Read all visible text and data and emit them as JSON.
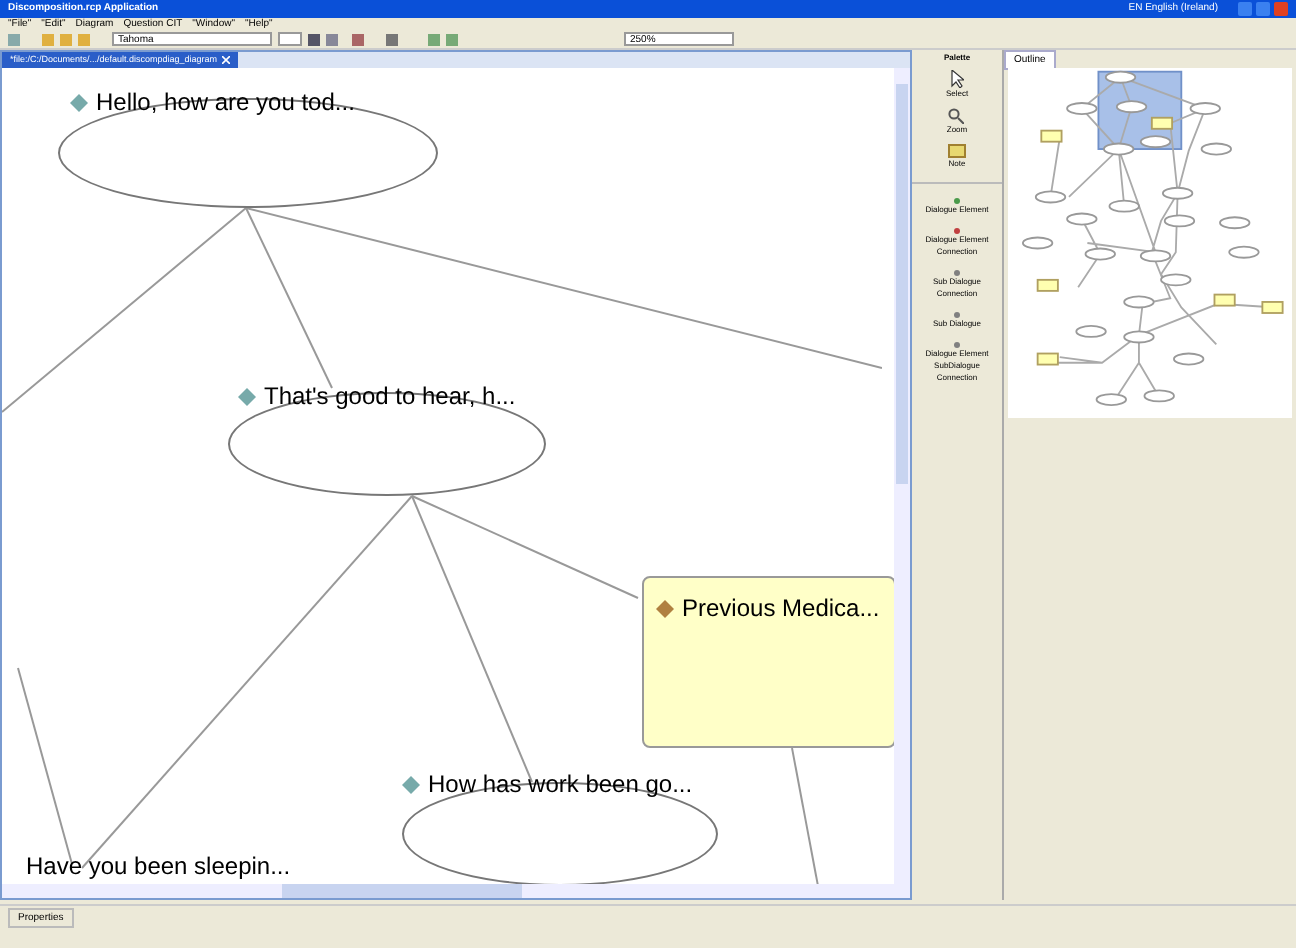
{
  "window": {
    "title": "Discomposition.rcp Application",
    "language": "EN English (Ireland)"
  },
  "menu": [
    "\"File\"",
    "\"Edit\"",
    "Diagram",
    "Question CIT",
    "\"Window\"",
    "\"Help\""
  ],
  "toolbar": {
    "font": "Tahoma",
    "zoom": "250%"
  },
  "editor": {
    "tab": "*file:/C:/Documents/.../default.discompdiag_diagram",
    "nodes": [
      {
        "kind": "ellipse",
        "label": "Hello, how are you tod..."
      },
      {
        "kind": "ellipse",
        "label": "That's good to hear, h..."
      },
      {
        "kind": "note",
        "label": "Previous Medica..."
      },
      {
        "kind": "ellipse",
        "label": "How has work been go..."
      },
      {
        "kind": "plain",
        "label": "Have you been sleepin..."
      }
    ]
  },
  "palette": {
    "title": "Palette",
    "tools": [
      {
        "kind": "select",
        "label": "Select"
      },
      {
        "kind": "zoom",
        "label": "Zoom"
      },
      {
        "kind": "note",
        "label": "Note"
      }
    ],
    "items": [
      {
        "label": "Dialogue Element",
        "color": "#4a9a4a"
      },
      {
        "label": "Dialogue Element Connection",
        "color": "#c04040"
      },
      {
        "label": "Sub Dialogue Connection",
        "color": "#808080"
      },
      {
        "label": "Sub Dialogue",
        "color": "#808080"
      },
      {
        "label": "Dialogue Element SubDialogue Connection",
        "color": "#808080"
      }
    ]
  },
  "outline": {
    "tab": "Outline"
  },
  "properties": {
    "tab": "Properties"
  }
}
